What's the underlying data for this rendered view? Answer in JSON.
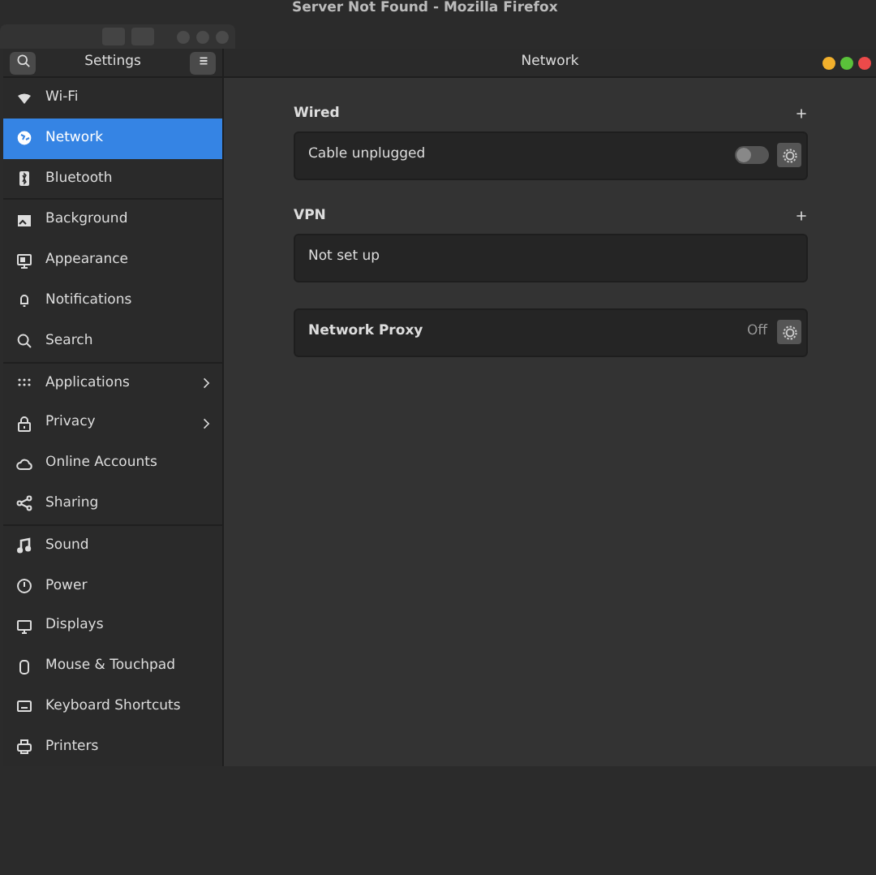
{
  "background_window": {
    "title": "Server Not Found - Mozilla Firefox"
  },
  "window": {
    "sidebar_title": "Settings",
    "title": "Network"
  },
  "sidebar": {
    "groups": [
      [
        {
          "label": "Wi-Fi",
          "selected": false,
          "submenu": false
        },
        {
          "label": "Network",
          "selected": true,
          "submenu": false
        },
        {
          "label": "Bluetooth",
          "selected": false,
          "submenu": false
        }
      ],
      [
        {
          "label": "Background",
          "selected": false,
          "submenu": false
        },
        {
          "label": "Appearance",
          "selected": false,
          "submenu": false
        },
        {
          "label": "Notifications",
          "selected": false,
          "submenu": false
        },
        {
          "label": "Search",
          "selected": false,
          "submenu": false
        }
      ],
      [
        {
          "label": "Applications",
          "selected": false,
          "submenu": true
        },
        {
          "label": "Privacy",
          "selected": false,
          "submenu": true
        },
        {
          "label": "Online Accounts",
          "selected": false,
          "submenu": false
        },
        {
          "label": "Sharing",
          "selected": false,
          "submenu": false
        }
      ],
      [
        {
          "label": "Sound",
          "selected": false,
          "submenu": false
        },
        {
          "label": "Power",
          "selected": false,
          "submenu": false
        },
        {
          "label": "Displays",
          "selected": false,
          "submenu": false
        },
        {
          "label": "Mouse & Touchpad",
          "selected": false,
          "submenu": false
        },
        {
          "label": "Keyboard Shortcuts",
          "selected": false,
          "submenu": false
        },
        {
          "label": "Printers",
          "selected": false,
          "submenu": false
        }
      ]
    ]
  },
  "sections": [
    {
      "heading": "Wired",
      "rows": [
        {
          "kind": "toggle",
          "label": "Cable unplugged",
          "on": false
        }
      ]
    },
    {
      "heading": "VPN",
      "rows": [
        {
          "kind": "plain",
          "label": "Not set up"
        }
      ]
    },
    {
      "rows": [
        {
          "kind": "status",
          "label": "Network Proxy",
          "status": "Off"
        }
      ]
    }
  ]
}
